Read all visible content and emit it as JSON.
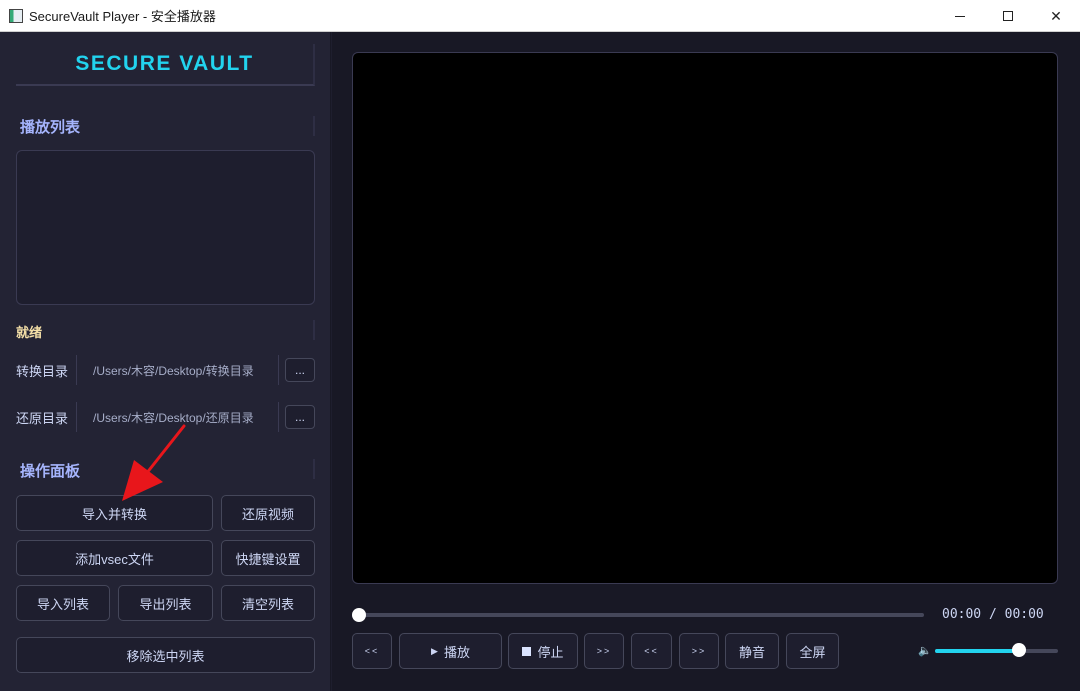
{
  "window": {
    "title": "SecureVault Player - 安全播放器"
  },
  "sidebar": {
    "brand": "SECURE VAULT",
    "playlist_title": "播放列表",
    "status": "就绪",
    "dirs": [
      {
        "label": "转换目录",
        "path": "/Users/木容/Desktop/转换目录",
        "browse": "..."
      },
      {
        "label": "还原目录",
        "path": "/Users/木容/Desktop/还原目录",
        "browse": "..."
      }
    ],
    "panel_title": "操作面板",
    "buttons": {
      "import_convert": "导入并转换",
      "restore_video": "还原视频",
      "add_vsec": "添加vsec文件",
      "hotkey_settings": "快捷键设置",
      "import_list": "导入列表",
      "export_list": "导出列表",
      "clear_list": "清空列表",
      "remove_selected": "移除选中列表"
    }
  },
  "player": {
    "progress": 0,
    "time": "00:00 / 00:00",
    "controls": {
      "rewind": "<<",
      "play": "播放",
      "stop": "停止",
      "next": ">>",
      "prev": "<<",
      "forward": ">>",
      "mute": "静音",
      "fullscreen": "全屏"
    },
    "volume": 0.68
  },
  "colors": {
    "accent": "#22d3ee",
    "section_title": "#a5b4fc",
    "status": "#f5e0a8",
    "annotation_arrow": "#e8161b"
  }
}
